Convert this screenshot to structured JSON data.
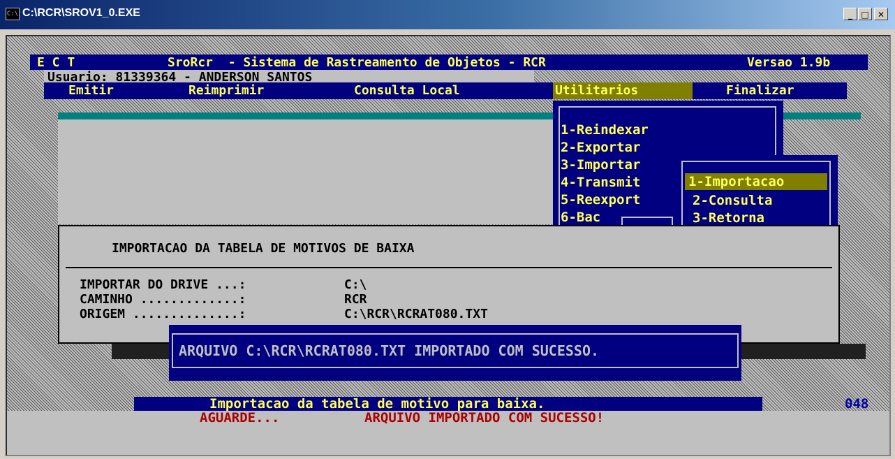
{
  "window": {
    "title": "C:\\RCR\\SROV1_0.EXE",
    "minimize": "_",
    "maximize": "□",
    "close": "✕"
  },
  "header": {
    "ect": "E C T",
    "title": "SroRcr  - Sistema de Rastreamento de Objetos - RCR",
    "version": "Versao 1.9b",
    "user": "Usuario: 81339364 - ANDERSON SANTOS"
  },
  "menu": {
    "emitir": "Emitir",
    "reimprimir": "Reimprimir",
    "consulta_local": "Consulta Local",
    "utilitarios": "Utilitarios",
    "finalizar": "Finalizar"
  },
  "utilitarios_menu": {
    "items": [
      "1-Reindexar",
      "2-Exportar",
      "3-Importar",
      "4-Transmit",
      "5-Reexport",
      "6-Bac"
    ]
  },
  "importar_menu": {
    "items": [
      "1-Importacao",
      "2-Consulta",
      "3-Retorna"
    ]
  },
  "dialog": {
    "title": "IMPORTACAO DA TABELA DE MOTIVOS DE BAIXA",
    "drive_label": "IMPORTAR DO DRIVE ...:",
    "drive_value": "C:\\",
    "caminho_label": "CAMINHO .............:",
    "caminho_value": "RCR",
    "origem_label": "ORIGEM ..............:",
    "origem_value": "C:\\RCR\\RCRAT080.TXT"
  },
  "message": "ARQUIVO C:\\RCR\\RCRAT080.TXT IMPORTADO COM SUCESSO.",
  "status": {
    "text": "Importacao da tabela de motivo para baixa.",
    "code": "048",
    "aguarde": "AGUARDE...",
    "result": "ARQUIVO IMPORTADO COM SUCESSO!"
  },
  "colors": {
    "console_blue": "#000080",
    "console_yellow": "#ffff55",
    "menu_highlight": "#808000",
    "teal": "#008080",
    "error_red": "#aa0000"
  }
}
